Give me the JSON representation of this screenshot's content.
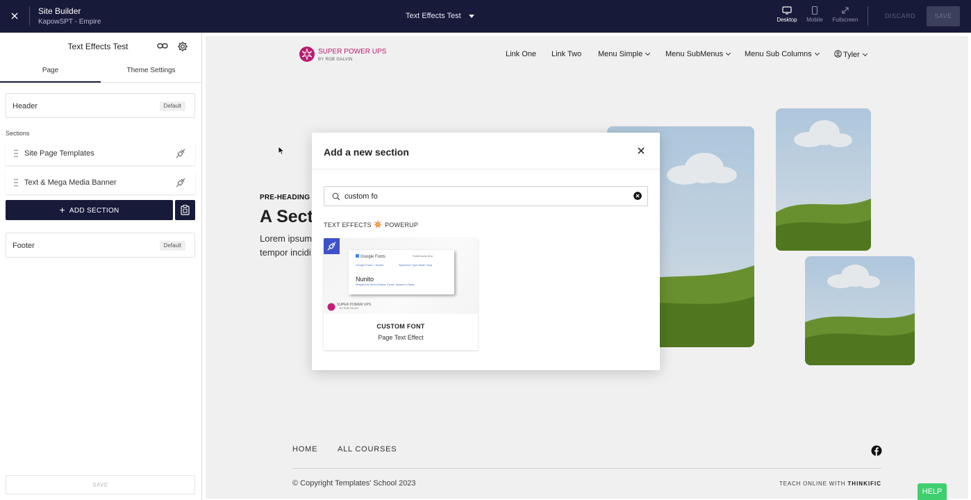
{
  "topbar": {
    "app_title": "Site Builder",
    "app_subtitle": "KapowSPT - Empire",
    "page_select": "Text Effects Test",
    "devices": [
      {
        "label": "Desktop",
        "active": true
      },
      {
        "label": "Mobile",
        "active": false
      },
      {
        "label": "Fullscreen",
        "active": false
      }
    ],
    "discard_label": "DISCARD",
    "save_label": "SAVE"
  },
  "sidebar": {
    "title": "Text Effects Test",
    "tabs": [
      {
        "label": "Page",
        "active": true
      },
      {
        "label": "Theme Settings",
        "active": false
      }
    ],
    "header": {
      "label": "Header",
      "badge": "Default"
    },
    "sections_label": "Sections",
    "sections": [
      {
        "label": "Site Page Templates"
      },
      {
        "label": "Text & Mega Media Banner"
      }
    ],
    "add_section_label": "ADD SECTION",
    "footer": {
      "label": "Footer",
      "badge": "Default"
    },
    "save_label": "SAVE"
  },
  "site": {
    "logo": {
      "brand": "SUPER POWER UPS",
      "byline": "BY ROB GALVIN"
    },
    "nav": [
      "Link One",
      "Link Two",
      "Menu Simple",
      "Menu SubMenus",
      "Menu Sub Columns",
      "Tyler"
    ],
    "pre_heading": "PRE-HEADING",
    "heading": "A Sect",
    "body_line1": "Lorem ipsum",
    "body_line2": "tempor incidi",
    "footer_nav": [
      "HOME",
      "ALL COURSES"
    ],
    "copyright": "© Copyright Templates' School 2023",
    "teach_prefix": "TEACH ONLINE WITH",
    "teach_brand": "THINKIFIC"
  },
  "modal": {
    "title": "Add a new section",
    "search_value": "custom fo",
    "category_left": "TEXT EFFECTS",
    "category_right": "POWERUP",
    "results": [
      {
        "name": "CUSTOM FONT",
        "description": "Page Text Effect",
        "preview": {
          "google_fonts": "Google Fonts",
          "header_links": "Fonts     Icons     Kno",
          "breadcrumb": "Google Fonts  >  Nunito",
          "breadcrumb_right": "Specimen       Type tester      Glyp",
          "font_name": "Nunito",
          "designed_by": "Designed by Vernon Adams, Cyreal, Jacques Le Bailly",
          "mini_logo_brand": "SUPER POWER UPS",
          "mini_logo_by": "BY ROB GALVIN"
        }
      }
    ]
  },
  "help_label": "HELP",
  "colors": {
    "topbar_bg": "#181a3a",
    "brand_magenta": "#c41e78",
    "powerup_blue": "#3f51c8",
    "help_green": "#3fcf6e"
  }
}
